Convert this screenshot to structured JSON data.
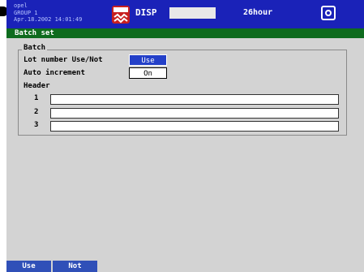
{
  "status": {
    "user": "opel",
    "group": "GROUP 1",
    "datetime": "Apr.18.2002 14:01:49"
  },
  "display": {
    "mode_label": "DISP",
    "timebase": "26hour"
  },
  "page": {
    "title": "Batch set"
  },
  "batch": {
    "section_label": "Batch",
    "lot_number_label": "Lot number Use/Not",
    "lot_number_value": "Use",
    "auto_increment_label": "Auto increment",
    "auto_increment_value": "On"
  },
  "header": {
    "label": "Header",
    "lines": [
      {
        "number": "1",
        "value": ""
      },
      {
        "number": "2",
        "value": ""
      },
      {
        "number": "3",
        "value": ""
      }
    ]
  },
  "softkeys": {
    "use": "Use",
    "not": "Not"
  },
  "colors": {
    "title_bar": "#1a22b8",
    "subtitle_bar": "#0e6b1e",
    "panel_bg": "#d3d3d3",
    "selected_value": "#2440c8"
  }
}
